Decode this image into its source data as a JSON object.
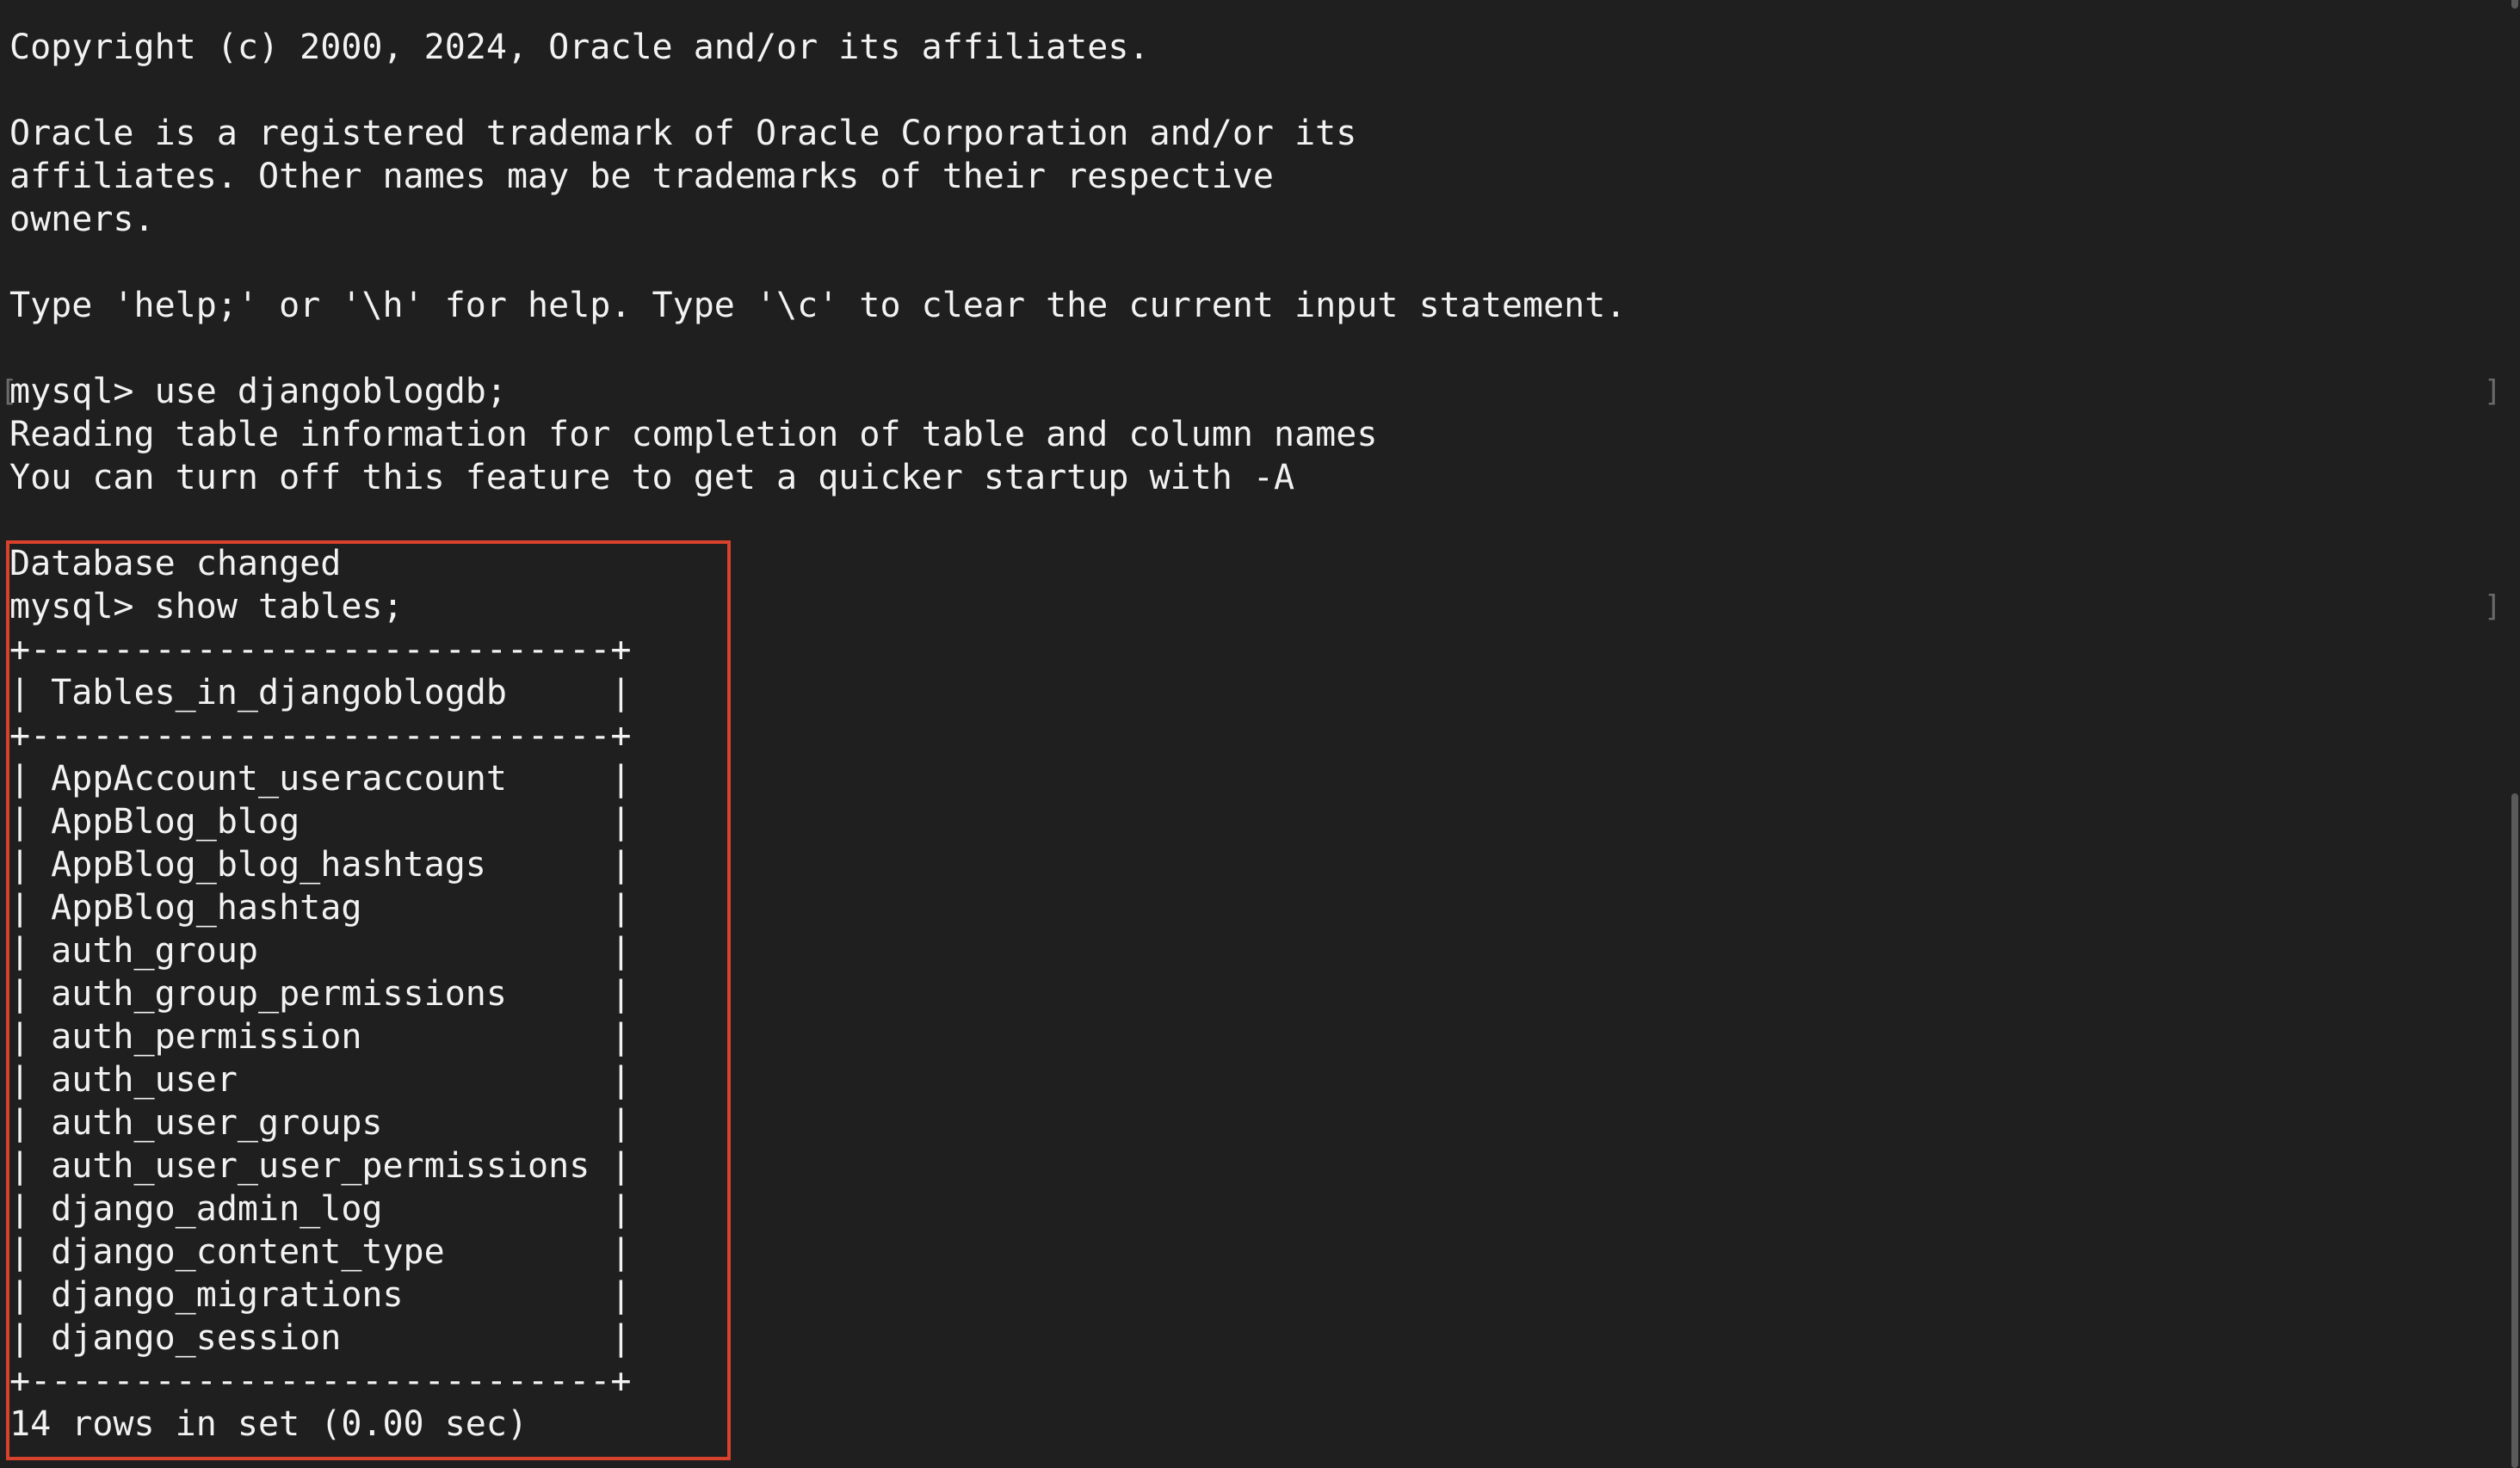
{
  "terminal": {
    "lines": [
      "Copyright (c) 2000, 2024, Oracle and/or its affiliates.",
      "",
      "Oracle is a registered trademark of Oracle Corporation and/or its",
      "affiliates. Other names may be trademarks of their respective",
      "owners.",
      "",
      "Type 'help;' or '\\h' for help. Type '\\c' to clear the current input statement.",
      "",
      "mysql> use djangoblogdb;",
      "Reading table information for completion of table and column names",
      "You can turn off this feature to get a quicker startup with -A",
      "",
      "Database changed",
      "mysql> show tables;",
      "+----------------------------+",
      "| Tables_in_djangoblogdb     |",
      "+----------------------------+",
      "| AppAccount_useraccount     |",
      "| AppBlog_blog               |",
      "| AppBlog_blog_hashtags      |",
      "| AppBlog_hashtag            |",
      "| auth_group                 |",
      "| auth_group_permissions     |",
      "| auth_permission            |",
      "| auth_user                  |",
      "| auth_user_groups           |",
      "| auth_user_user_permissions |",
      "| django_admin_log           |",
      "| django_content_type        |",
      "| django_migrations          |",
      "| django_session             |",
      "+----------------------------+",
      "14 rows in set (0.00 sec)"
    ],
    "prompt_left_mark": "[",
    "prompt_right_mark": "]",
    "colors": {
      "background": "#1f1f1f",
      "text": "#f2f2f2",
      "highlight_border": "#d8412c"
    }
  }
}
